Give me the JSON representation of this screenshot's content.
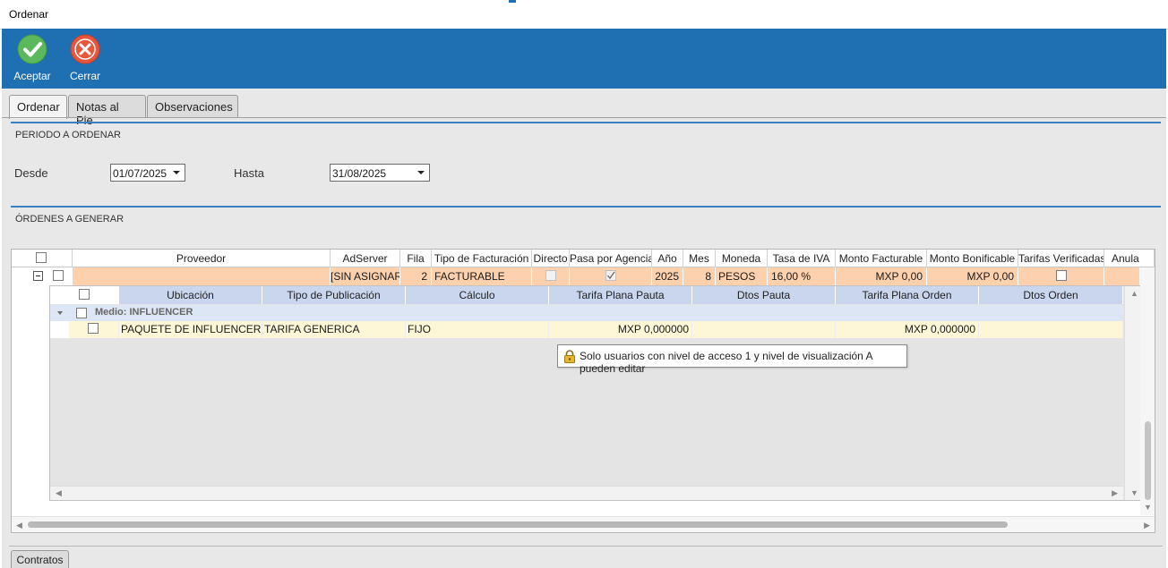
{
  "window": {
    "title": "Ordenar"
  },
  "toolbar": {
    "accept_label": "Aceptar",
    "close_label": "Cerrar"
  },
  "tabs": [
    "Ordenar",
    "Notas al Pie",
    "Observaciones"
  ],
  "period": {
    "section_title": "PERIODO A ORDENAR",
    "from_label": "Desde",
    "from_value": "01/07/2025",
    "to_label": "Hasta",
    "to_value": "31/08/2025"
  },
  "orders": {
    "section_title": "ÓRDENES A GENERAR",
    "columns": [
      "Proveedor",
      "AdServer",
      "Fila",
      "Tipo de Facturación",
      "Directo",
      "Pasa por Agencia",
      "Año",
      "Mes",
      "Moneda",
      "Tasa de IVA",
      "Monto Facturable",
      "Monto Bonificable",
      "Tarifas Verificadas",
      "Anula"
    ],
    "row": {
      "proveedor": "",
      "adserver": "[SIN ASIGNAR]",
      "fila": "2",
      "tipo_facturacion": "FACTURABLE",
      "directo": false,
      "pasa_por_agencia": true,
      "anio": "2025",
      "mes": "8",
      "moneda": "PESOS",
      "tasa_iva": "16,00 %",
      "monto_facturable": "MXP 0,00",
      "monto_bonificable": "MXP 0,00",
      "tarifas_verificadas": false
    }
  },
  "detail": {
    "columns": [
      "Ubicación",
      "Tipo de Publicación",
      "Cálculo",
      "Tarifa Plana Pauta",
      "Dtos Pauta",
      "Tarifa Plana Orden",
      "Dtos Orden"
    ],
    "group_label": "Medio: INFLUENCER",
    "row": {
      "ubicacion": "PAQUETE DE INFLUENCERS",
      "tipo_publicacion": "TARIFA GENERICA",
      "calculo": "FIJO",
      "tarifa_plana_pauta": "MXP 0,000000",
      "dtos_pauta": "",
      "tarifa_plana_orden": "MXP 0,000000",
      "dtos_orden": ""
    }
  },
  "tooltip": {
    "text": "Solo usuarios con nivel de acceso 1 y nivel de visualización A pueden editar"
  },
  "bottom_tab": {
    "label": "Contratos"
  },
  "colors": {
    "ribbon": "#1f6fb3",
    "accept_icon": "#5cb85c",
    "close_icon": "#e8553d",
    "order_row": "#fdd1ad",
    "detail_header": "#c9d6ee",
    "detail_row": "#fdf7d8"
  },
  "icons": {
    "accept": "check-circle-icon",
    "close": "x-circle-icon",
    "lock": "lock-icon"
  }
}
